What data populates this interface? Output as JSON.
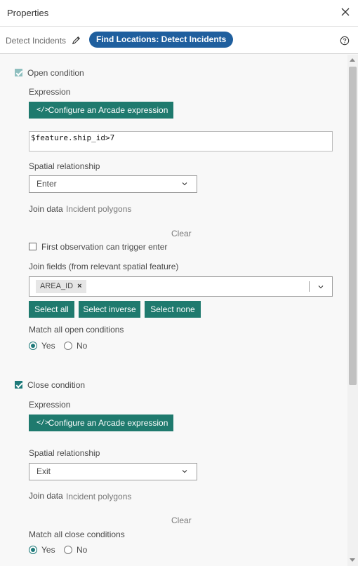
{
  "header": {
    "title": "Properties"
  },
  "subbar": {
    "name": "Detect Incidents",
    "pill": "Find Locations: Detect Incidents"
  },
  "open": {
    "checkbox_label": "Open condition",
    "expression_label": "Expression",
    "configure_button": "Configure an Arcade expression",
    "expression_value": "$feature.ship_id>7",
    "spatial_label": "Spatial relationship",
    "spatial_value": "Enter",
    "join_label": "Join data",
    "join_value": "Incident polygons",
    "clear": "Clear",
    "first_obs": "First observation can trigger enter",
    "join_fields_label": "Join fields (from relevant spatial feature)",
    "chip": "AREA_ID",
    "select_all": "Select all",
    "select_inverse": "Select inverse",
    "select_none": "Select none",
    "match_label": "Match all open conditions",
    "yes": "Yes",
    "no": "No"
  },
  "close": {
    "checkbox_label": "Close condition",
    "expression_label": "Expression",
    "configure_button": "Configure an Arcade expression",
    "spatial_label": "Spatial relationship",
    "spatial_value": "Exit",
    "join_label": "Join data",
    "join_value": "Incident polygons",
    "clear": "Clear",
    "match_label": "Match all close conditions",
    "yes": "Yes",
    "no": "No"
  },
  "colors": {
    "accent": "#1f7a6e",
    "pill": "#1f5f9e"
  }
}
